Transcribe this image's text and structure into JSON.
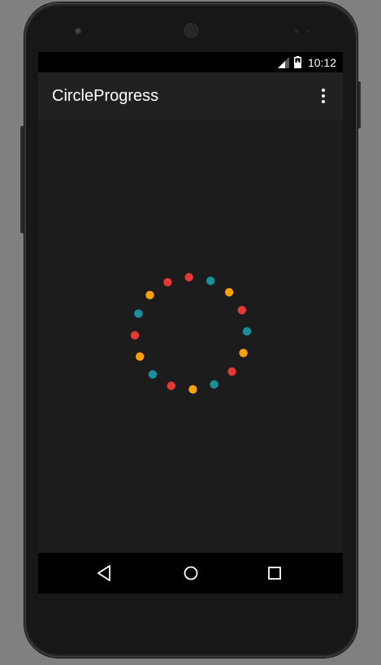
{
  "status_bar": {
    "time": "10:12",
    "icons": [
      "signal-icon",
      "battery-icon"
    ]
  },
  "app_bar": {
    "title": "CircleProgress",
    "menu_icon": "more-vert-icon"
  },
  "progress": {
    "dot_count": 16,
    "colors": [
      "#e53935",
      "#17919b",
      "#ffa000"
    ],
    "background": "#1c1c1c"
  },
  "nav_bar": {
    "icons": [
      "back-icon",
      "home-icon",
      "recents-icon"
    ]
  }
}
